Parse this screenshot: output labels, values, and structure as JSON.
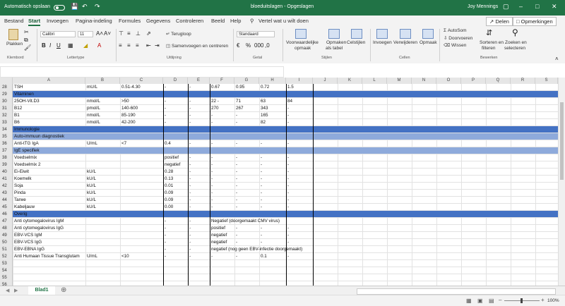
{
  "titlebar": {
    "autosave_label": "Automatisch opslaan",
    "doc_title": "bloeduitslagen - Opgeslagen",
    "user": "Joy Mennings"
  },
  "tabs": [
    "Bestand",
    "Start",
    "Invoegen",
    "Pagina-indeling",
    "Formules",
    "Gegevens",
    "Controleren",
    "Beeld",
    "Help"
  ],
  "search_placeholder": "Vertel wat u wilt doen",
  "share_label": "Delen",
  "comments_label": "Opmerkingen",
  "ribbon": {
    "paste": "Plakken",
    "clipboard": "Klembord",
    "font_name": "Calibri",
    "font_size": "11",
    "font_group": "Lettertype",
    "wrap": "Terugloop",
    "merge": "Samenvoegen en centreren",
    "align_group": "Uitlijning",
    "number_format": "Standaard",
    "number_group": "Getal",
    "cond_format_1": "Voorwaardelijke",
    "cond_format_2": "opmaak",
    "format_table_1": "Opmaken",
    "format_table_2": "als tabel",
    "cell_styles_1": "Celstijlen",
    "styles_group": "Stijlen",
    "insert": "Invoegen",
    "delete": "Verwijderen",
    "format": "Opmaak",
    "cells_group": "Cellen",
    "autosum": "AutoSom",
    "fill": "Doorvoeren",
    "clear": "Wissen",
    "sort_1": "Sorteren en",
    "sort_2": "filteren",
    "find_1": "Zoeken en",
    "find_2": "selecteren",
    "editing_group": "Bewerken"
  },
  "columns": [
    "A",
    "B",
    "C",
    "D",
    "E",
    "F",
    "G",
    "H",
    "I",
    "J",
    "K",
    "L",
    "M",
    "N",
    "O",
    "P",
    "Q",
    "R",
    "S"
  ],
  "rows": [
    {
      "n": "28",
      "type": "data",
      "cells": [
        "TSH",
        "mU/L",
        "0.51-4.30",
        "-",
        "-",
        "0.67",
        "0.95",
        "0.72",
        "1.5"
      ]
    },
    {
      "n": "29",
      "type": "section",
      "cells": [
        "Vitaminen"
      ]
    },
    {
      "n": "30",
      "type": "data",
      "cells": [
        "25OH-Vit.D3",
        "nmol/L",
        ">50",
        "-",
        "-",
        "22 -",
        "71",
        "63",
        "84"
      ]
    },
    {
      "n": "31",
      "type": "data",
      "cells": [
        "B12",
        "pmol/L",
        "140-600",
        "-",
        "-",
        "270",
        "267",
        "343",
        "-"
      ]
    },
    {
      "n": "32",
      "type": "data",
      "cells": [
        "B1",
        "nmol/L",
        "85-190",
        "-",
        "-",
        "-",
        "-",
        "165",
        "-"
      ]
    },
    {
      "n": "33",
      "type": "data",
      "cells": [
        "B6",
        "nmol/L",
        "42-200",
        "-",
        "-",
        "-",
        "-",
        "82",
        "-"
      ]
    },
    {
      "n": "34",
      "type": "section",
      "cells": [
        "Immunologie"
      ]
    },
    {
      "n": "35",
      "type": "subsection",
      "cells": [
        "Auto-immuun diagnostiek"
      ]
    },
    {
      "n": "36",
      "type": "data",
      "cells": [
        "Anti-tTG IgA",
        "U/mL",
        "<7",
        "0.4",
        "-",
        "-",
        "-",
        "-",
        "-"
      ]
    },
    {
      "n": "37",
      "type": "subsection",
      "cells": [
        "IgE specifiek"
      ]
    },
    {
      "n": "38",
      "type": "data",
      "cells": [
        "Voedselmix",
        "",
        "",
        "positief",
        "-",
        "-",
        "-",
        "-",
        "-"
      ]
    },
    {
      "n": "39",
      "type": "data",
      "cells": [
        "Voedselmix 2",
        "",
        "",
        "negatief",
        "-",
        "-",
        "-",
        "-",
        "-"
      ]
    },
    {
      "n": "40",
      "type": "data",
      "cells": [
        "Ei-Eiwit",
        "kU/L",
        "",
        "0.28",
        "-",
        "-",
        "-",
        "-",
        "-"
      ]
    },
    {
      "n": "41",
      "type": "data",
      "cells": [
        "Koemelk",
        "kU/L",
        "",
        "0.13",
        "-",
        "-",
        "-",
        "-",
        "-"
      ]
    },
    {
      "n": "42",
      "type": "data",
      "cells": [
        "Soja",
        "kU/L",
        "",
        "0.01",
        "-",
        "-",
        "-",
        "-",
        "-"
      ]
    },
    {
      "n": "43",
      "type": "data",
      "cells": [
        "Pinda",
        "kU/L",
        "",
        "0.09",
        "-",
        "-",
        "-",
        "-",
        "-"
      ]
    },
    {
      "n": "44",
      "type": "data",
      "cells": [
        "Tarwe",
        "kU/L",
        "",
        "0.09",
        "-",
        "-",
        "-",
        "-",
        "-"
      ]
    },
    {
      "n": "45",
      "type": "data",
      "cells": [
        "Kabeljauw",
        "kU/L",
        "",
        "0.00",
        "-",
        "-",
        "-",
        "-",
        "-"
      ]
    },
    {
      "n": "46",
      "type": "section",
      "cells": [
        "Overig"
      ]
    },
    {
      "n": "47",
      "type": "data",
      "cells": [
        "Anti cytomegalovirus IgM",
        "",
        "",
        "-",
        "-",
        "Negatief (doorgemaakt CMV virus)",
        "",
        "",
        ""
      ]
    },
    {
      "n": "48",
      "type": "data",
      "cells": [
        "Anti cytomegalovirus IgG",
        "",
        "",
        "-",
        "-",
        "positief",
        "-",
        "-",
        "-"
      ]
    },
    {
      "n": "49",
      "type": "data",
      "cells": [
        "EBV-VCS IgM",
        "",
        "",
        "-",
        "-",
        "negatief",
        "-",
        "-",
        "-"
      ]
    },
    {
      "n": "50",
      "type": "data",
      "cells": [
        "EBV-VCS IgG",
        "",
        "",
        "-",
        "-",
        "negatief",
        "-",
        "-",
        "-"
      ]
    },
    {
      "n": "51",
      "type": "data",
      "cells": [
        "EBV-EBNA IgG",
        "",
        "",
        "-",
        "-",
        "negatief (nog geen EBV-infectie doorgemaakt)",
        "",
        "",
        ""
      ]
    },
    {
      "n": "52",
      "type": "data",
      "cells": [
        "Anti Humaan Tissue Transglutam",
        "U/mL",
        "<10",
        "-",
        "-",
        "-",
        "-",
        "0.1",
        "-"
      ]
    },
    {
      "n": "53",
      "type": "empty",
      "cells": []
    },
    {
      "n": "54",
      "type": "empty",
      "cells": []
    },
    {
      "n": "55",
      "type": "empty",
      "cells": []
    },
    {
      "n": "56",
      "type": "empty",
      "cells": []
    }
  ],
  "sheet_tab": "Blad1",
  "zoom": "100%"
}
